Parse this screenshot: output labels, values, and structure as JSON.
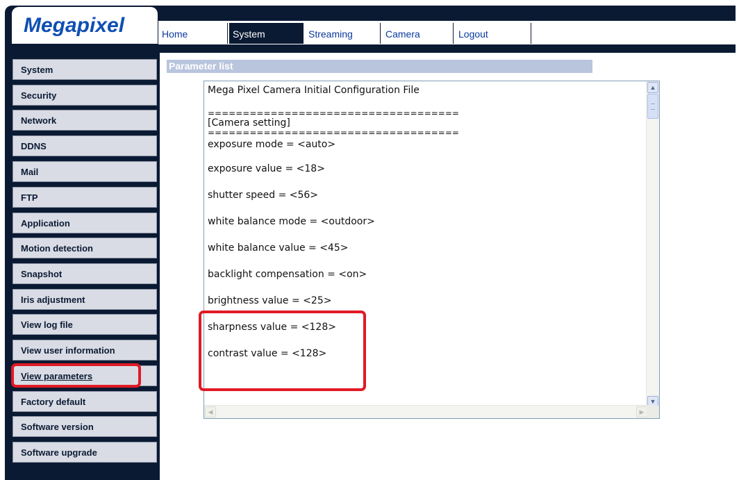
{
  "logo": {
    "text": "Megapixel"
  },
  "nav": {
    "tabs": [
      {
        "label": "Home"
      },
      {
        "label": "System"
      },
      {
        "label": "Streaming"
      },
      {
        "label": "Camera"
      },
      {
        "label": "Logout"
      }
    ],
    "active_tab": "System"
  },
  "sidebar": {
    "items": [
      {
        "label": "System"
      },
      {
        "label": "Security"
      },
      {
        "label": "Network"
      },
      {
        "label": "DDNS"
      },
      {
        "label": "Mail"
      },
      {
        "label": "FTP"
      },
      {
        "label": "Application"
      },
      {
        "label": "Motion detection"
      },
      {
        "label": "Snapshot"
      },
      {
        "label": "Iris adjustment"
      },
      {
        "label": "View log file"
      },
      {
        "label": "View user information"
      },
      {
        "label": "View parameters"
      },
      {
        "label": "Factory default"
      },
      {
        "label": "Software version"
      },
      {
        "label": "Software upgrade"
      }
    ],
    "selected": "View parameters"
  },
  "main": {
    "header": "Parameter list",
    "params": {
      "title": "Mega Pixel Camera Initial Configuration File",
      "separator": "====================================",
      "section": "[Camera setting]",
      "lines": [
        "exposure mode = <auto>",
        "exposure value = <18>",
        "shutter speed = <56>",
        "white balance mode = <outdoor>",
        "white balance value = <45>",
        "backlight compensation = <on>",
        "brightness value = <25>",
        "sharpness value = <128>",
        "contrast value = <128>"
      ]
    }
  },
  "colors": {
    "frame": "#0b1a33",
    "logo": "#0f4fb3",
    "link": "#0a3a9c",
    "header_bg": "#b9c5dd",
    "sidebar_bg": "#d9dce4",
    "highlight": "#e01a24"
  }
}
